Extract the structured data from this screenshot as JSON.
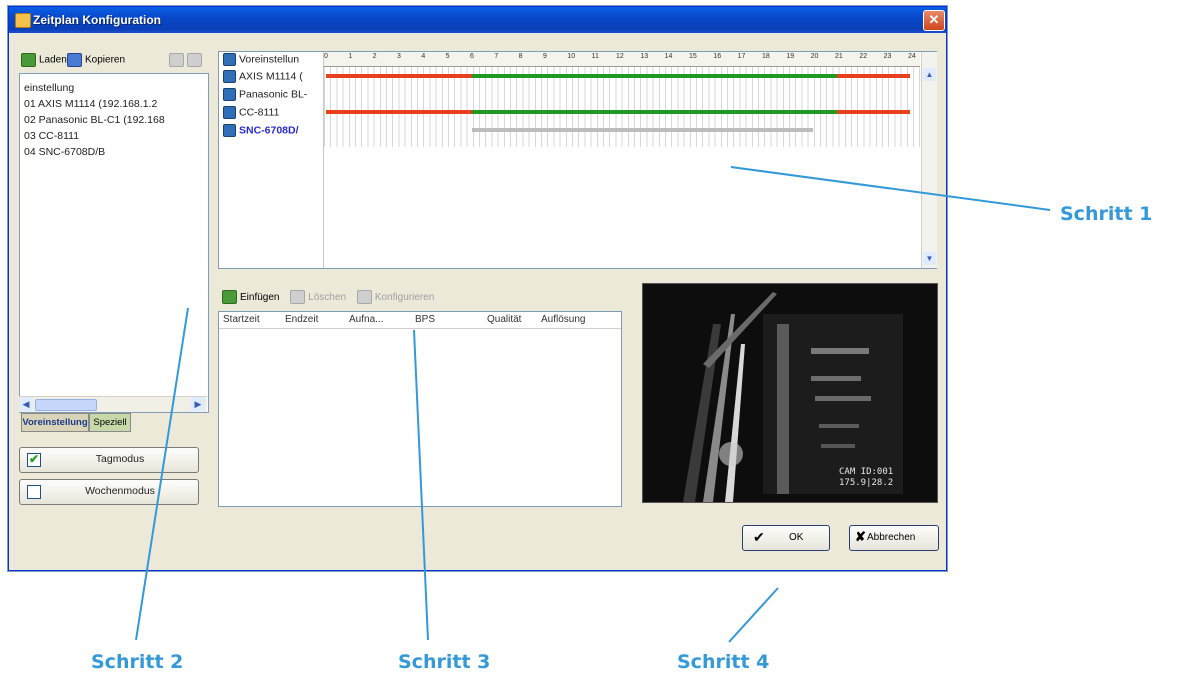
{
  "window": {
    "title": "Zeitplan Konfiguration",
    "close_glyph": "✕"
  },
  "left_toolbar": {
    "load": "Laden",
    "copy": "Kopieren"
  },
  "left_list": [
    "einstellung",
    "01 AXIS M1114 (192.168.1.2",
    "02 Panasonic BL-C1 (192.168",
    "03 CC-8111",
    "04 SNC-6708D/B"
  ],
  "tabs": {
    "preset": "Voreinstellung",
    "special": "Speziell"
  },
  "modes": {
    "day": "Tagmodus",
    "week": "Wochenmodus"
  },
  "schedule": {
    "header_label": "Voreinstellun",
    "hours": [
      "0",
      "1",
      "2",
      "3",
      "4",
      "5",
      "6",
      "7",
      "8",
      "9",
      "10",
      "11",
      "12",
      "13",
      "14",
      "15",
      "16",
      "17",
      "18",
      "19",
      "20",
      "21",
      "22",
      "23",
      "24"
    ],
    "cameras": [
      "AXIS M1114 (",
      "Panasonic BL-",
      "CC-8111",
      "SNC-6708D/"
    ],
    "colors": {
      "red": "#e8401c",
      "green": "#1e9a22",
      "grey": "#bcbcbc"
    },
    "bars": [
      {
        "row": 0,
        "segments": [
          {
            "from": 0,
            "to": 6,
            "color": "red"
          },
          {
            "from": 6,
            "to": 21,
            "color": "green"
          },
          {
            "from": 21,
            "to": 24,
            "color": "red"
          }
        ]
      },
      {
        "row": 2,
        "segments": [
          {
            "from": 0,
            "to": 6,
            "color": "red"
          },
          {
            "from": 6,
            "to": 21,
            "color": "green"
          },
          {
            "from": 21,
            "to": 24,
            "color": "red"
          }
        ]
      },
      {
        "row": 3,
        "segments": [
          {
            "from": 6,
            "to": 20,
            "color": "grey"
          }
        ]
      }
    ]
  },
  "lower_toolbar": {
    "insert": "Einfügen",
    "delete": "Löschen",
    "configure": "Konfigurieren"
  },
  "table": {
    "columns": [
      "Startzeit",
      "Endzeit",
      "Aufna...",
      "BPS",
      "Qualität",
      "Auflösung"
    ]
  },
  "video": {
    "osd": "CAM ID:001\n175.9|28.2"
  },
  "buttons": {
    "ok": "OK",
    "cancel": "Abbrechen"
  },
  "steps": [
    "Schritt 1",
    "Schritt 2",
    "Schritt 3",
    "Schritt 4"
  ]
}
